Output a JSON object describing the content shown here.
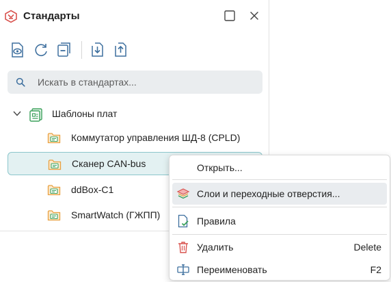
{
  "panel": {
    "title": "Стандарты",
    "title_icon": "standards-icon"
  },
  "toolbar": {
    "buttons": [
      "view-icon",
      "refresh-icon",
      "collapse-icon",
      "import-icon",
      "export-icon"
    ]
  },
  "search": {
    "placeholder": "Искать в стандартах..."
  },
  "tree": {
    "group": {
      "label": "Шаблоны плат",
      "expanded": true
    },
    "items": [
      {
        "label": "Коммутатор управления ШД-8 (CPLD)"
      },
      {
        "label": "Сканер CAN-bus",
        "selected": true
      },
      {
        "label": "ddBox-C1"
      },
      {
        "label": "SmartWatch (ГЖПП)"
      }
    ]
  },
  "context_menu": {
    "items": [
      {
        "label": "Открыть...",
        "shortcut": ""
      },
      {
        "label": "Слои и переходные отверстия...",
        "shortcut": "",
        "icon": "layers-icon"
      },
      {
        "label": "Правила",
        "shortcut": "",
        "icon": "rules-icon"
      },
      {
        "label": "Удалить",
        "shortcut": "Delete",
        "icon": "trash-icon"
      },
      {
        "label": "Переименовать",
        "shortcut": "F2",
        "icon": "rename-icon"
      }
    ]
  },
  "colors": {
    "accent_red": "#d9534f",
    "folder_orange": "#e8a040",
    "board_green": "#3aa05a",
    "selection_bg": "#e3f1f2",
    "selection_border": "#8bc6cb",
    "icon_blue": "#3d6f9e"
  }
}
